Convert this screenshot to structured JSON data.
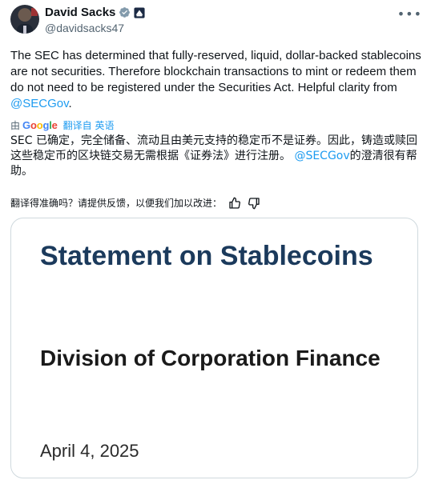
{
  "author": {
    "name": "David Sacks",
    "handle": "@davidsacks47",
    "verified_color": "#1d9bf0"
  },
  "tweet": {
    "text_before_mention": "The SEC has determined that fully-reserved, liquid, dollar-backed stablecoins are not securities. Therefore blockchain transactions to mint or redeem them do not need to be registered under the Securities Act. Helpful clarity from ",
    "mention": "@SECGov",
    "text_after_mention": "."
  },
  "translation": {
    "by_label": "由",
    "google_logo": "Google",
    "translated_from": "翻译自 英语",
    "zh_before_mention": "SEC 已确定，完全储备、流动且由美元支持的稳定币不是证券。因此，铸造或赎回这些稳定币的区块链交易无需根据《证券法》进行注册。",
    "zh_mention": "@SECGov",
    "zh_after_mention": "的澄清很有帮助。",
    "feedback_prompt": "翻译得准确吗？请提供反馈，以便我们加以改进："
  },
  "card": {
    "title": "Statement on Stablecoins",
    "subtitle": "Division of Corporation Finance",
    "date": "April 4, 2025",
    "title_color": "#1b3a5c"
  },
  "icons": {
    "more": "more-icon",
    "verified": "verified-badge-icon",
    "affiliation": "affiliation-badge-icon",
    "thumbs_up": "thumbs-up-icon",
    "thumbs_down": "thumbs-down-icon"
  }
}
